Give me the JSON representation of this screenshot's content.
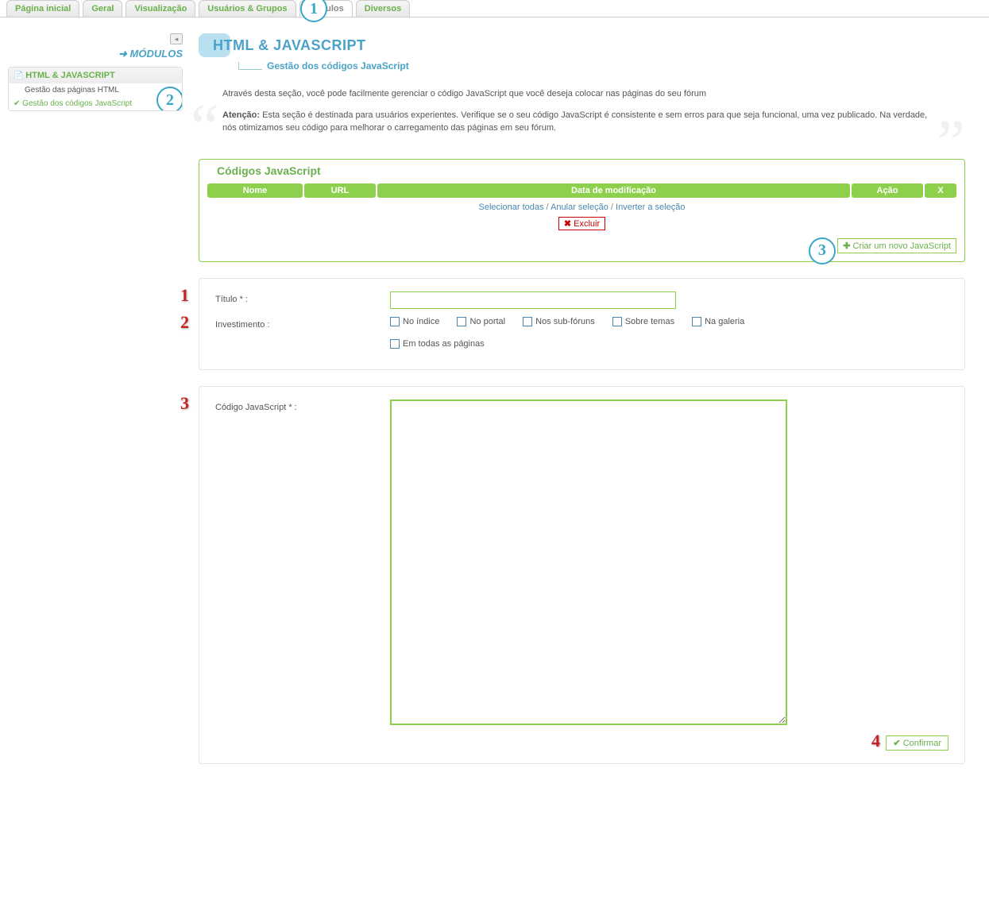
{
  "tabs": [
    "Página inicial",
    "Geral",
    "Visualização",
    "Usuários & Grupos",
    "Módulos",
    "Diversos"
  ],
  "activeTab": "Módulos",
  "sidebar": {
    "heading": "MÓDULOS",
    "panelTitle": "HTML & JAVASCRIPT",
    "items": [
      "Gestão das páginas HTML",
      "Gestão dos códigos JavaScript"
    ]
  },
  "page": {
    "title": "HTML & JAVASCRIPT",
    "subtitle": "Gestão dos códigos JavaScript",
    "intro1": "Através desta seção, você pode facilmente gerenciar o código JavaScript que você deseja colocar nas páginas do seu fórum",
    "intro2_strong": "Atenção:",
    "intro2_rest": " Esta seção é destinada para usuários experientes. Verifique se o seu código JavaScript é consistente e sem erros para que seja funcional, uma vez publicado. Na verdade, nós otimizamos seu código para melhorar o carregamento das páginas em seu fórum."
  },
  "tableSection": {
    "legend": "Códigos JavaScript",
    "headers": [
      "Nome",
      "URL",
      "Data de modificação",
      "Ação",
      "X"
    ],
    "selectAll": "Selecionar todas",
    "deselect": "Anular seleção",
    "invert": "Inverter a seleção",
    "deleteBtn": "Excluir",
    "createBtn": "Criar um novo JavaScript"
  },
  "form": {
    "titleLabel": "Título * :",
    "placementLabel": "Investimento :",
    "checks": [
      "No índice",
      "No portal",
      "Nos sub-fóruns",
      "Sobre temas",
      "Na galeria",
      "Em todas as páginas"
    ],
    "codeLabel": "Código JavaScript * :",
    "confirmBtn": "Confirmar"
  },
  "callouts": {
    "c1": "1",
    "c2": "2",
    "c3": "3",
    "r1": "1",
    "r2": "2",
    "r3": "3",
    "r4": "4"
  }
}
